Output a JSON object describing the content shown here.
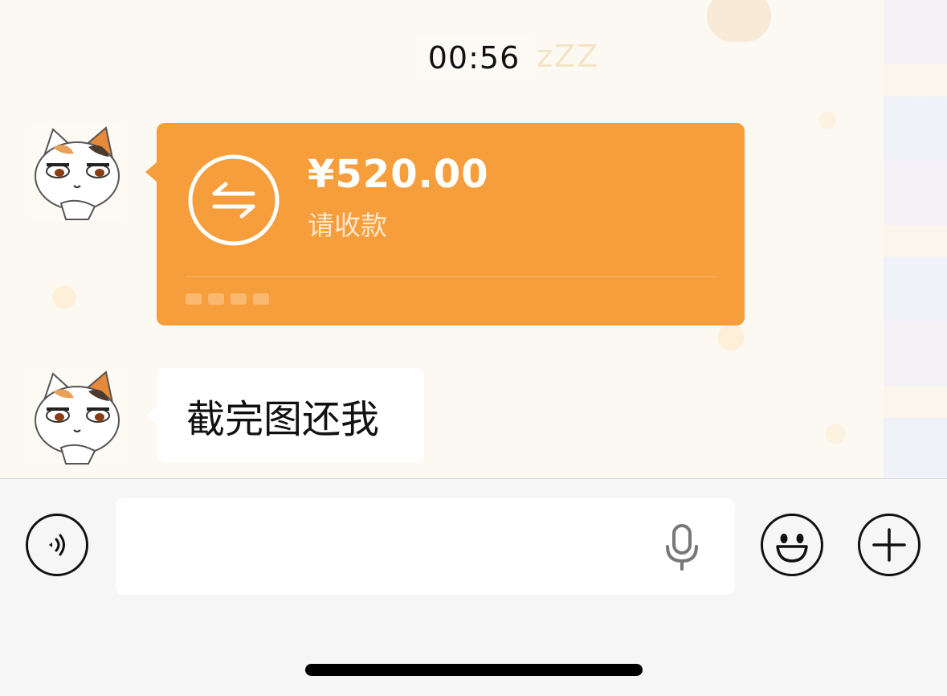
{
  "chat": {
    "timestamp": "00:56",
    "messages": [
      {
        "type": "transfer",
        "amount": "¥520.00",
        "status": "请收款",
        "accent_color": "#f79e3c"
      },
      {
        "type": "text",
        "text": "截完图还我"
      }
    ]
  },
  "input_bar": {
    "value": "",
    "voice_icon": "voice-mode-icon",
    "mic_icon": "microphone-icon",
    "emoji_icon": "emoji-icon",
    "plus_icon": "plus-icon"
  }
}
